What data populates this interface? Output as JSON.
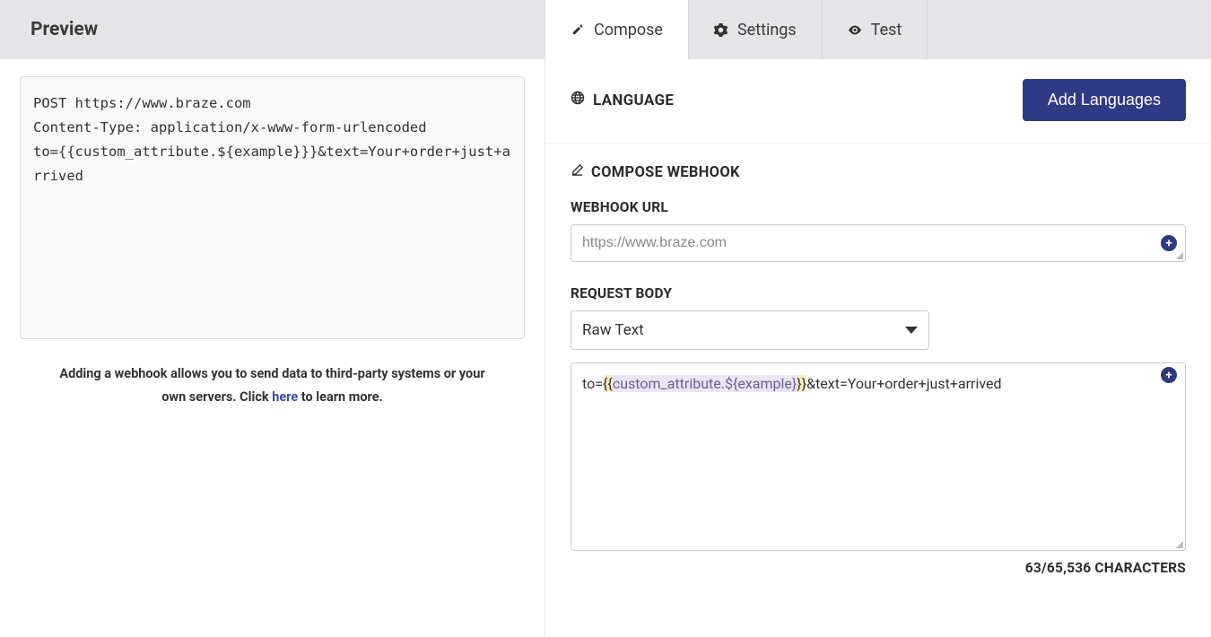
{
  "preview": {
    "title": "Preview",
    "code": "POST https://www.braze.com\nContent-Type: application/x-www-form-urlencoded\nto={{custom_attribute.${example}}}&text=Your+order+just+arrived",
    "help_before": "Adding a webhook allows you to send data to third-party systems or your own servers. Click ",
    "help_link": "here",
    "help_after": " to learn more."
  },
  "tabs": {
    "compose": "Compose",
    "settings": "Settings",
    "test": "Test"
  },
  "language": {
    "label": "LANGUAGE",
    "button": "Add Languages"
  },
  "compose": {
    "heading": "COMPOSE WEBHOOK",
    "url_label": "WEBHOOK URL",
    "url_value": "https://www.braze.com",
    "body_label": "REQUEST BODY",
    "body_type": "Raw Text",
    "body_pre": "to=",
    "body_brace_open": "{{",
    "body_inner": "custom_attribute.${example}",
    "body_brace_close": "}}",
    "body_post": "&text=Your+order+just+arrived",
    "char_count": "63/65,536 CHARACTERS"
  }
}
